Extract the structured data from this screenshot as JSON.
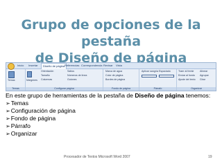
{
  "slide": {
    "title_line1": "Grupo de opciones de la pestaña",
    "title_line2": "de Diseño de página"
  },
  "ribbon": {
    "tabs": [
      "Inicio",
      "Insertar",
      "Diseño de página",
      "Referencias",
      "Correspondencia",
      "Revisar",
      "Vista"
    ],
    "active_tab": "Diseño de página",
    "groups": [
      {
        "label": "Temas",
        "items": [
          "Temas"
        ]
      },
      {
        "label": "Configurar página",
        "items": [
          "Orientación",
          "Tamaño",
          "Columnas",
          "Saltos",
          "Números de línea",
          "Guiones",
          "Márgenes"
        ]
      },
      {
        "label": "Fondo de página",
        "items": [
          "Marca de agua",
          "Color de página",
          "Bordes de página"
        ]
      },
      {
        "label": "Párrafo",
        "items": [
          "Aplicar sangría",
          "Espaciado"
        ]
      },
      {
        "label": "Organizar",
        "items": [
          "Traer al frente",
          "Enviar al fondo",
          "Ajuste del texto",
          "Alinear",
          "Agrupar",
          "Girar"
        ]
      }
    ]
  },
  "content": {
    "intro_prefix": "En este grupo de herramientas de la pestaña de ",
    "intro_bold": "Diseño de página",
    "intro_suffix": " tenemos:",
    "items": [
      "Temas",
      "Configuración de página",
      "Fondo de página",
      "Párrafo",
      "Organizar"
    ]
  },
  "footer": {
    "center": "Procesador de Textos Microsoft Word 2007",
    "page": "19"
  },
  "colors": {
    "title": "#5b8fa8",
    "ribbon_bg": "#e9eff7"
  }
}
